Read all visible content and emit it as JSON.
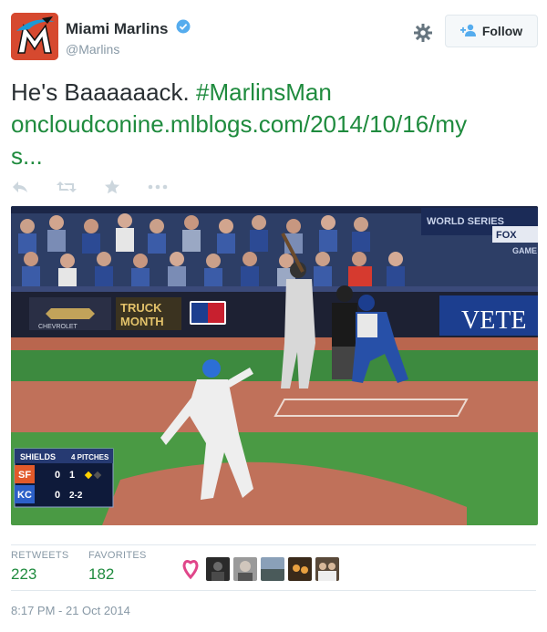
{
  "header": {
    "display_name": "Miami Marlins",
    "screen_name": "@Marlins",
    "avatar_icon": "marlins-logo",
    "verified_icon": "verified-badge-icon",
    "settings_icon": "gear-icon",
    "follow_label": "Follow"
  },
  "tweet": {
    "text_plain": "He's Baaaaaack. ",
    "hashtag": "#MarlinsMan",
    "link_line1": "oncloudconine.mlblogs.com/2014/10/16/my",
    "link_line2": "s..."
  },
  "actions": [
    "reply-icon",
    "retweet-icon",
    "favorite-icon",
    "more-icon"
  ],
  "media": {
    "scorebug": {
      "pitcher": "SHIELDS",
      "pitches": "4 PITCHES",
      "team1": "SF",
      "score1": "0",
      "inning": "1",
      "team2": "KC",
      "score2": "0",
      "count": "2-2"
    },
    "banner_world_series": "WORLD SERIES",
    "banner_fox": "FOX",
    "banner_game": "GAME",
    "ad_truck": "TRUCK",
    "ad_month": "MONTH",
    "ad_chevrolet": "CHEVROLET",
    "ad_vete": "VETE"
  },
  "stats": {
    "retweets_label": "RETWEETS",
    "retweets_value": "223",
    "favorites_label": "FAVORITES",
    "favorites_value": "182"
  },
  "timestamp": "8:17 PM - 21 Oct 2014",
  "colors": {
    "link": "#1f8b3e",
    "muted": "#8899a6",
    "marlins_orange": "#d6492f"
  }
}
